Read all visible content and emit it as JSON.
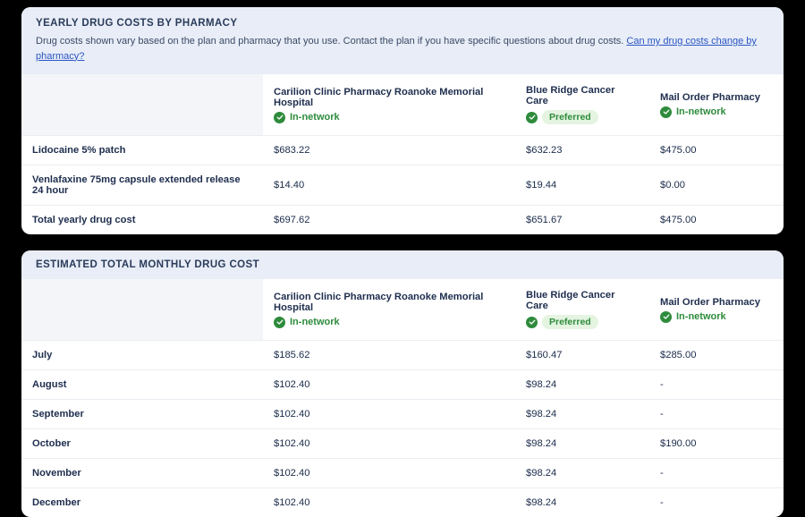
{
  "yearly": {
    "title": "YEARLY DRUG COSTS BY PHARMACY",
    "desc_prefix": "Drug costs shown vary based on the plan and pharmacy that you use. Contact the plan if you have specific questions about drug costs. ",
    "desc_link": "Can my drug costs change by pharmacy?",
    "pharmacies": [
      {
        "name": "Carilion Clinic Pharmacy Roanoke Memorial Hospital",
        "status": "In-network",
        "kind": "in"
      },
      {
        "name": "Blue Ridge Cancer Care",
        "status": "Preferred",
        "kind": "pref"
      },
      {
        "name": "Mail Order Pharmacy",
        "status": "In-network",
        "kind": "in"
      }
    ],
    "rows": [
      {
        "label": "Lidocaine 5% patch",
        "v": [
          "$683.22",
          "$632.23",
          "$475.00"
        ]
      },
      {
        "label": "Venlafaxine 75mg capsule extended release 24 hour",
        "v": [
          "$14.40",
          "$19.44",
          "$0.00"
        ]
      },
      {
        "label": "Total yearly drug cost",
        "v": [
          "$697.62",
          "$651.67",
          "$475.00"
        ]
      }
    ]
  },
  "monthly": {
    "title": "ESTIMATED TOTAL MONTHLY DRUG COST",
    "pharmacies": [
      {
        "name": "Carilion Clinic Pharmacy Roanoke Memorial Hospital",
        "status": "In-network",
        "kind": "in"
      },
      {
        "name": "Blue Ridge Cancer Care",
        "status": "Preferred",
        "kind": "pref"
      },
      {
        "name": "Mail Order Pharmacy",
        "status": "In-network",
        "kind": "in"
      }
    ],
    "rows": [
      {
        "label": "July",
        "v": [
          "$185.62",
          "$160.47",
          "$285.00"
        ]
      },
      {
        "label": "August",
        "v": [
          "$102.40",
          "$98.24",
          "-"
        ]
      },
      {
        "label": "September",
        "v": [
          "$102.40",
          "$98.24",
          "-"
        ]
      },
      {
        "label": "October",
        "v": [
          "$102.40",
          "$98.24",
          "$190.00"
        ]
      },
      {
        "label": "November",
        "v": [
          "$102.40",
          "$98.24",
          "-"
        ]
      },
      {
        "label": "December",
        "v": [
          "$102.40",
          "$98.24",
          "-"
        ]
      }
    ]
  }
}
